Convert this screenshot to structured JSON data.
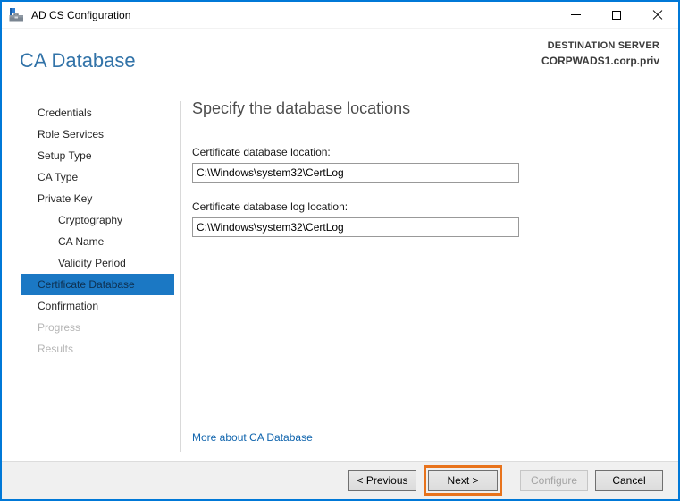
{
  "window": {
    "title": "AD CS Configuration"
  },
  "header": {
    "page_title": "CA Database",
    "destination_label": "DESTINATION SERVER",
    "destination_server": "CORPWADS1.corp.priv"
  },
  "sidebar": {
    "items": [
      {
        "label": "Credentials",
        "state": "normal",
        "indent": 0
      },
      {
        "label": "Role Services",
        "state": "normal",
        "indent": 0
      },
      {
        "label": "Setup Type",
        "state": "normal",
        "indent": 0
      },
      {
        "label": "CA Type",
        "state": "normal",
        "indent": 0
      },
      {
        "label": "Private Key",
        "state": "normal",
        "indent": 0
      },
      {
        "label": "Cryptography",
        "state": "normal",
        "indent": 1
      },
      {
        "label": "CA Name",
        "state": "normal",
        "indent": 1
      },
      {
        "label": "Validity Period",
        "state": "normal",
        "indent": 1
      },
      {
        "label": "Certificate Database",
        "state": "selected",
        "indent": 0
      },
      {
        "label": "Confirmation",
        "state": "normal",
        "indent": 0
      },
      {
        "label": "Progress",
        "state": "disabled",
        "indent": 0
      },
      {
        "label": "Results",
        "state": "disabled",
        "indent": 0
      }
    ]
  },
  "content": {
    "heading": "Specify the database locations",
    "fields": [
      {
        "label": "Certificate database location:",
        "value": "C:\\Windows\\system32\\CertLog"
      },
      {
        "label": "Certificate database log location:",
        "value": "C:\\Windows\\system32\\CertLog"
      }
    ],
    "link_label": "More about CA Database"
  },
  "footer": {
    "buttons": [
      {
        "label": "< Previous",
        "state": "normal"
      },
      {
        "label": "Next >",
        "state": "normal",
        "highlighted": true
      },
      {
        "label": "Configure",
        "state": "disabled"
      },
      {
        "label": "Cancel",
        "state": "normal"
      }
    ]
  },
  "colors": {
    "window_border": "#0078d7",
    "selected_nav_bg": "#1b78c4",
    "selected_nav_text": "#0e3050",
    "page_title": "#3273a8",
    "link": "#0f64ad",
    "annotation_orange": "#e8731c",
    "footer_bg": "#f0f0f0"
  }
}
